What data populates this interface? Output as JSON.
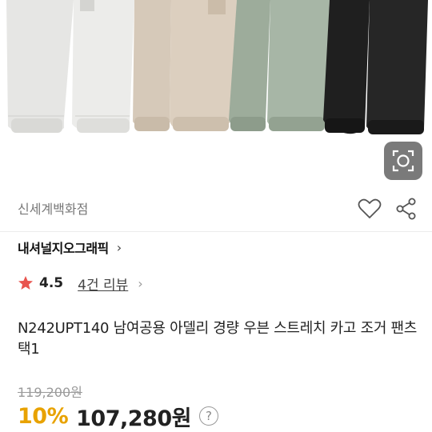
{
  "store": {
    "name": "신세계백화점"
  },
  "brand": {
    "name": "내셔널지오그래픽",
    "chevron": "›"
  },
  "rating": {
    "star_color": "#e8544e",
    "value": "4.5",
    "review_link": "4건 리뷰",
    "chevron": "›"
  },
  "product": {
    "title": "N242UPT140 남여공용 아델리 경량 우븐 스트레치 카고 조거 팬츠 택1",
    "original_price": "119,200원",
    "discount": "10%",
    "sale_price": "107,280원",
    "help_icon": "?"
  },
  "hero": {
    "pant_colors": [
      "#e3e3e1",
      "#d8cbbb",
      "#a3b1a1",
      "#222222"
    ]
  },
  "colors": {
    "accent": "#e8a200"
  },
  "icons": {
    "lens": "image-search-icon",
    "heart": "heart-icon",
    "share": "share-icon",
    "star": "star-icon",
    "help": "help-icon"
  }
}
